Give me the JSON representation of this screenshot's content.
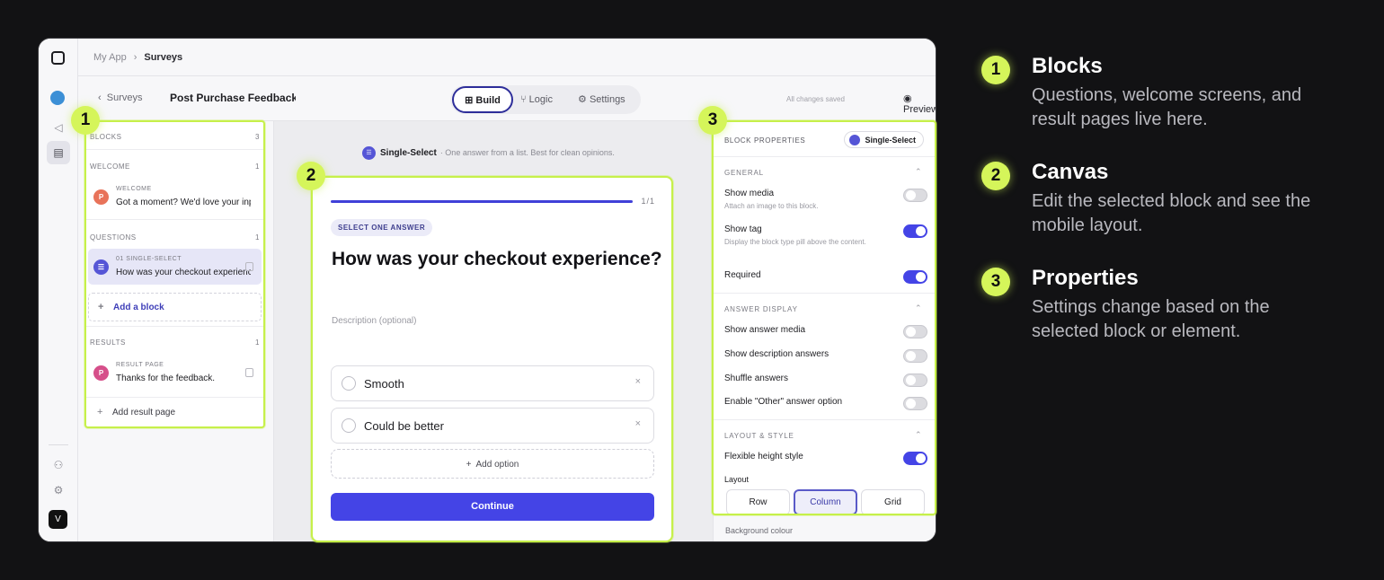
{
  "app": {
    "breadcrumb": [
      "My App",
      "Surveys"
    ],
    "back_label": "Surveys",
    "survey_title": "Post Purchase Feedback Survey",
    "tabs": [
      "Build",
      "Logic",
      "Settings"
    ],
    "saved_status": "All changes saved",
    "preview_label": "Preview",
    "user_initial": "V"
  },
  "type_hint": {
    "label": "Single-Select",
    "text": "· One answer from a list. Best for clean opinions."
  },
  "blocks": {
    "header": "BLOCKS",
    "header_count": "3",
    "welcome_section": "WELCOME",
    "welcome_count": "1",
    "welcome_item": {
      "kind": "WELCOME",
      "text": "Got a moment? We'd love your input",
      "icon": "P"
    },
    "questions_section": "QUESTIONS",
    "questions_count": "1",
    "question_item": {
      "kind": "01  SINGLE-SELECT",
      "text": "How was your checkout experience?"
    },
    "add_block": "Add a block",
    "results_section": "RESULTS",
    "results_count": "1",
    "result_item": {
      "kind": "RESULT PAGE",
      "text": "Thanks for the feedback.",
      "icon": "P"
    },
    "add_result": "Add result page"
  },
  "canvas": {
    "progress": "1/1",
    "progress_fraction": 1.0,
    "tag": "SELECT ONE ANSWER",
    "question": "How was your checkout experience?",
    "description_placeholder": "Description (optional)",
    "options": [
      "Smooth",
      "Could be better"
    ],
    "add_option": "Add option",
    "continue": "Continue"
  },
  "properties": {
    "header": "BLOCK PROPERTIES",
    "type": "Single-Select",
    "general": "GENERAL",
    "show_media": "Show media",
    "show_media_sub": "Attach an image to this block.",
    "show_tag": "Show tag",
    "show_tag_sub": "Display the block type pill above the content.",
    "required": "Required",
    "answer_display": "ANSWER DISPLAY",
    "show_answer_media": "Show answer media",
    "show_desc_answers": "Show description answers",
    "shuffle": "Shuffle answers",
    "other_option": "Enable \"Other\" answer option",
    "layout_style": "LAYOUT & STYLE",
    "flexible": "Flexible height style",
    "layout_label": "Layout",
    "layout_options": [
      "Row",
      "Column",
      "Grid"
    ],
    "selected_layout": "Column",
    "background_colour": "Background colour",
    "toggles": {
      "show_media": false,
      "show_tag": true,
      "required": true,
      "show_answer_media": false,
      "show_desc_answers": false,
      "shuffle": false,
      "other_option": false,
      "flexible": true
    }
  },
  "legend": [
    {
      "num": "1",
      "title": "Blocks",
      "desc": "Questions, welcome screens, and result pages live here."
    },
    {
      "num": "2",
      "title": "Canvas",
      "desc": "Edit the selected block and see the mobile layout."
    },
    {
      "num": "3",
      "title": "Properties",
      "desc": "Settings change based on the selected block or element."
    }
  ],
  "colors": {
    "accent": "#4444e6",
    "highlight": "#c6f04a",
    "badge": "#d5f55a",
    "background": "#121214"
  }
}
